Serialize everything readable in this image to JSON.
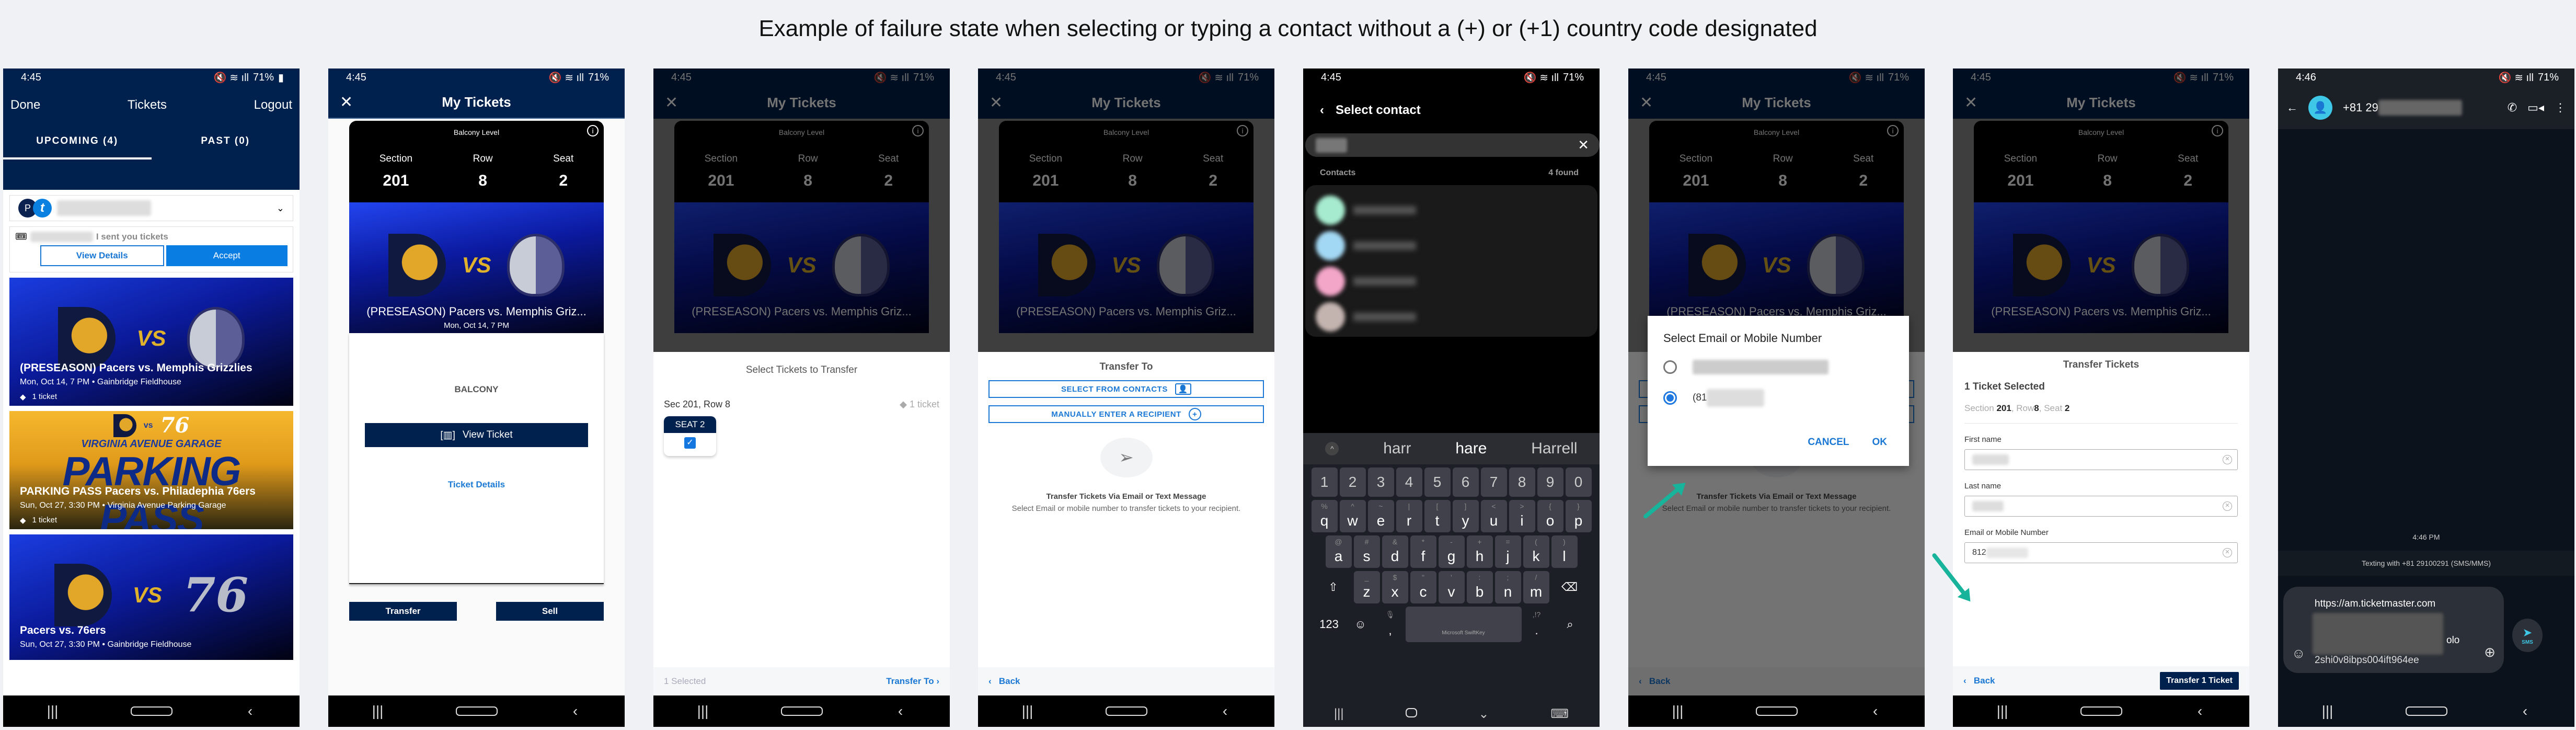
{
  "caption": "Example of failure state when selecting or typing a contact without a (+) or (+1) country code designated",
  "status": {
    "time_a": "4:45",
    "time_b": "4:46",
    "battery": "71%",
    "icons": "mute-icon wifi-icon signal-icon battery-icon"
  },
  "system_nav": {
    "recents": "|||",
    "home": "home-icon",
    "back": "‹"
  },
  "p1": {
    "done": "Done",
    "title": "Tickets",
    "logout": "Logout",
    "tabs": [
      {
        "label": "UPCOMING (4)",
        "active": true
      },
      {
        "label": "PAST (0)",
        "active": false
      }
    ],
    "account_initial_1": "P",
    "account_initial_2": "t",
    "notice_text": "I sent you tickets",
    "view_details": "View Details",
    "accept": "Accept",
    "events": [
      {
        "title": "(PRESEASON) Pacers vs. Memphis Grizzlies",
        "subtitle": "Mon, Oct 14, 7 PM • Gainbridge Fieldhouse",
        "count": "1 ticket",
        "vs": "VS"
      },
      {
        "banner_top": "VIRGINIA AVENUE GARAGE",
        "banner_big": "PARKING PASS",
        "title": "PARKING PASS Pacers vs. Philadephia 76ers",
        "subtitle": "Sun, Oct 27, 3:30 PM • Virginia Avenue Parking Garage",
        "count": "1 ticket",
        "vs": "vs",
        "opp": "76"
      },
      {
        "title": "Pacers vs. 76ers",
        "subtitle": "Sun, Oct 27, 3:30 PM • Gainbridge Fieldhouse",
        "vs": "VS",
        "opp": "76"
      }
    ]
  },
  "ticket": {
    "header_title": "My Tickets",
    "close": "✕",
    "level": "Balcony Level",
    "info": "i",
    "section_label": "Section",
    "section": "201",
    "row_label": "Row",
    "row": "8",
    "seat_label": "Seat",
    "seat": "2",
    "event_title": "(PRESEASON) Pacers vs. Memphis Griz...",
    "event_date": "Mon, Oct 14, 7 PM",
    "vs": "VS"
  },
  "p2": {
    "balcony": "BALCONY",
    "view_ticket": "View Ticket",
    "ticket_details": "Ticket Details",
    "transfer": "Transfer",
    "sell": "Sell"
  },
  "p3": {
    "heading": "Select Tickets to Transfer",
    "sec_row": "Sec 201, Row 8",
    "ticket_count": "1 ticket",
    "seat_label": "SEAT 2",
    "seat_checked": true,
    "selected": "1 Selected",
    "transfer_to": "Transfer To"
  },
  "p4": {
    "heading": "Transfer To",
    "select_contacts": "SELECT FROM CONTACTS",
    "manual_entry": "MANUALLY ENTER A RECIPIENT",
    "info_title": "Transfer Tickets Via Email or Text Message",
    "info_desc": "Select Email or mobile number to transfer tickets to your recipient.",
    "back": "Back"
  },
  "p5": {
    "title": "Select contact",
    "contacts_label": "Contacts",
    "found": "4 found",
    "contact_colors": [
      "#a6ebcf",
      "#a3d8f4",
      "#f4a6c8",
      "#c4b4b0"
    ],
    "suggestions": [
      "harr",
      "hare",
      "Harrell"
    ],
    "number_row": [
      "1",
      "2",
      "3",
      "4",
      "5",
      "6",
      "7",
      "8",
      "9",
      "0"
    ],
    "row1": [
      [
        "q",
        "%"
      ],
      [
        "w",
        "^"
      ],
      [
        "e",
        "~"
      ],
      [
        "r",
        "|"
      ],
      [
        "t",
        "["
      ],
      [
        "y",
        "]"
      ],
      [
        "u",
        "<"
      ],
      [
        "i",
        ">"
      ],
      [
        "o",
        "{"
      ],
      [
        "p",
        "}"
      ]
    ],
    "row2": [
      [
        "a",
        "@"
      ],
      [
        "s",
        "#"
      ],
      [
        "d",
        "&"
      ],
      [
        "f",
        "*"
      ],
      [
        "g",
        "-"
      ],
      [
        "h",
        "+"
      ],
      [
        "j",
        "="
      ],
      [
        "k",
        "("
      ],
      [
        "l",
        ")"
      ]
    ],
    "row3": [
      [
        "z",
        "_"
      ],
      [
        "x",
        "$"
      ],
      [
        "c",
        "\""
      ],
      [
        "v",
        "'"
      ],
      [
        "b",
        ":"
      ],
      [
        "n",
        ";"
      ],
      [
        "m",
        "/"
      ]
    ],
    "sym_key": "123",
    "comma": ",",
    "period": ".",
    "space_label": "Microsoft SwiftKey"
  },
  "p6": {
    "dialog_title": "Select Email or Mobile Number",
    "option_phone_prefix": "(81",
    "cancel": "CANCEL",
    "ok": "OK",
    "selected_option": 2,
    "back": "Back"
  },
  "p7": {
    "heading": "Transfer Tickets",
    "selected": "1 Ticket Selected",
    "section_label": "Section",
    "section": "201",
    "row_label": "Row",
    "row": "8",
    "seat_label": "Seat",
    "seat": "2",
    "first_name_label": "First name",
    "last_name_label": "Last name",
    "contact_label": "Email or Mobile Number",
    "contact_value_prefix": "812",
    "back": "Back",
    "transfer_button": "Transfer 1 Ticket"
  },
  "p8": {
    "contact_prefix": "+81 29",
    "timestamp": "4:46 PM",
    "texting_with": "Texting with +81 29100291 (SMS/MMS)",
    "message_url": "https://am.ticketmaster.com",
    "message_tail_1": "olo",
    "message_tail_2": "2shi0v8ibps004ift964ee",
    "send_label": "SMS"
  },
  "colors": {
    "navy": "#00214d",
    "accent_blue": "#1a78d4",
    "annotation_arrow": "#17b39a"
  }
}
